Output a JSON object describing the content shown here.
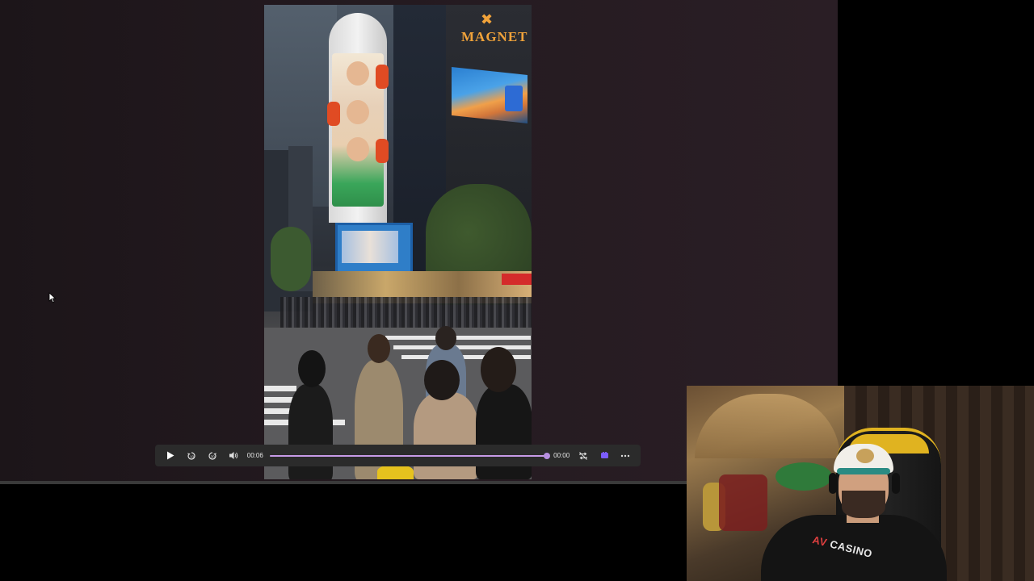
{
  "player": {
    "current_time": "00:06",
    "duration": "00:00",
    "progress": 1.0,
    "accent_color": "#c79ae8"
  },
  "video_scene": {
    "billboard_brand": "MAGNET"
  },
  "webcam": {
    "shirt_text_prefix": "AV",
    "shirt_text": "CASINO"
  },
  "icons": {
    "play": "play-icon",
    "rewind": "rewind-10-icon",
    "forward": "forward-30-icon",
    "volume": "volume-icon",
    "loop": "loop-icon",
    "ext": "extension-icon",
    "more": "more-icon",
    "cursor": "mouse-cursor-icon"
  }
}
